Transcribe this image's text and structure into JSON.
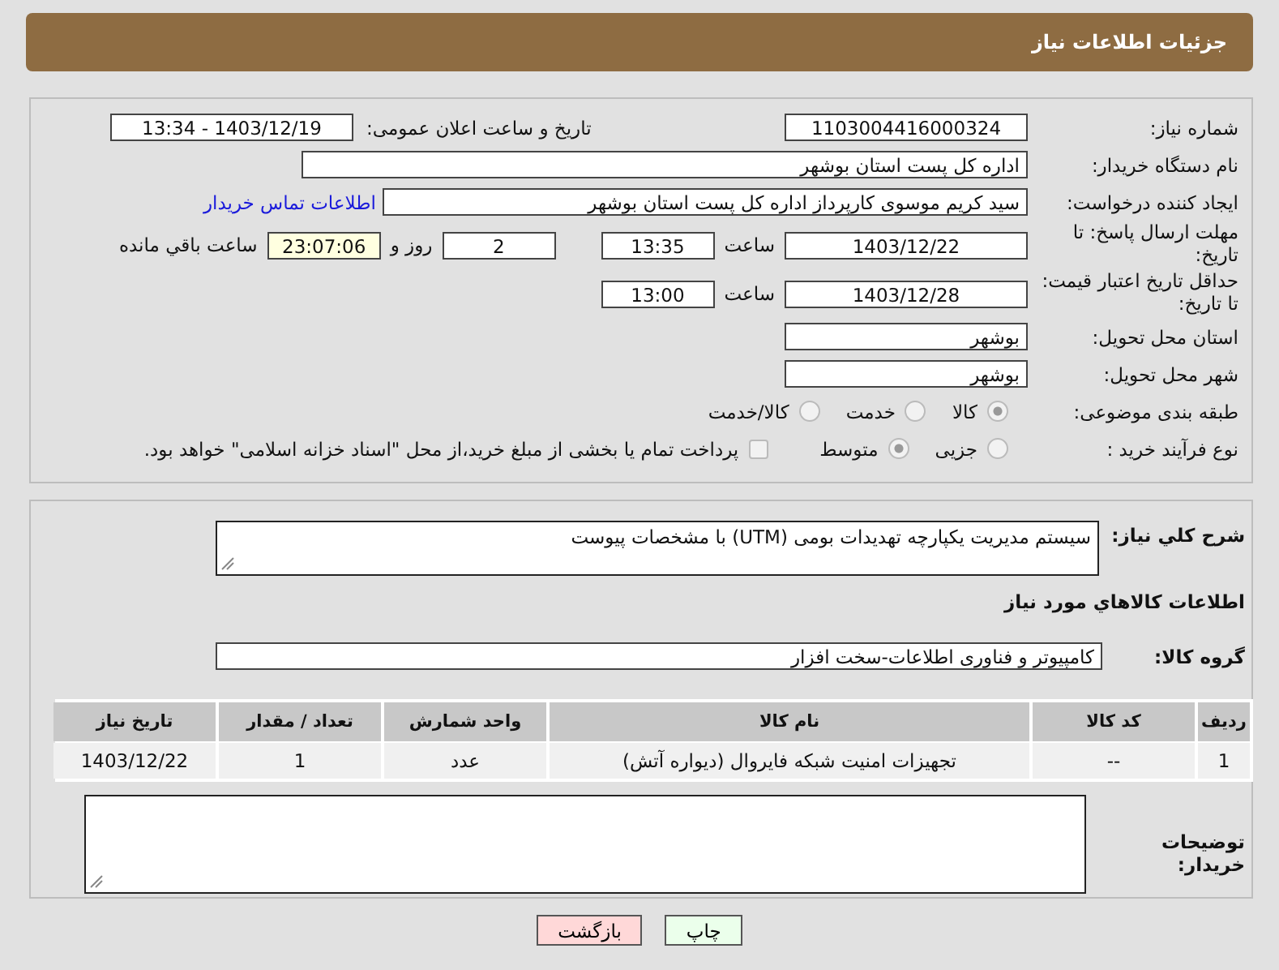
{
  "header": {
    "title": "جزئیات اطلاعات نیاز"
  },
  "need_number": {
    "label": "شماره نیاز:",
    "value": "1103004416000324"
  },
  "announce": {
    "label": "تاریخ و ساعت اعلان عمومی:",
    "value": "1403/12/19 - 13:34"
  },
  "buyer": {
    "label": "نام دستگاه خریدار:",
    "value": "اداره کل پست استان بوشهر"
  },
  "requester": {
    "label": "ایجاد کننده درخواست:",
    "value": "سید کریم موسوی کارپرداز اداره کل پست استان بوشهر",
    "link": "اطلاعات تماس خریدار"
  },
  "deadline": {
    "label": "مهلت ارسال پاسخ: تا تاریخ:",
    "date": "1403/12/22",
    "time_label": "ساعت",
    "time": "13:35",
    "days": "2",
    "days_label": "روز و",
    "remaining": "23:07:06",
    "remaining_label": "ساعت باقي مانده"
  },
  "validity": {
    "label": "حداقل تاریخ اعتبار قیمت: تا تاریخ:",
    "date": "1403/12/28",
    "time_label": "ساعت",
    "time": "13:00"
  },
  "province": {
    "label": "استان محل تحویل:",
    "value": "بوشهر"
  },
  "city": {
    "label": "شهر محل تحویل:",
    "value": "بوشهر"
  },
  "category": {
    "label": "طبقه بندی موضوعی:",
    "options": [
      {
        "label": "کالا",
        "selected": true
      },
      {
        "label": "خدمت",
        "selected": false
      },
      {
        "label": "کالا/خدمت",
        "selected": false
      }
    ]
  },
  "process": {
    "label": "نوع فرآیند خرید :",
    "options": [
      {
        "label": "جزیی",
        "selected": false
      },
      {
        "label": "متوسط",
        "selected": true
      }
    ],
    "payment": {
      "label": "پرداخت تمام یا بخشی از مبلغ خرید،از محل \"اسناد خزانه اسلامی\" خواهد بود.",
      "checked": false
    }
  },
  "description": {
    "label": "شرح کلي نياز:",
    "value": "سیستم مدیریت یکپارچه تهدیدات بومی  (UTM) با مشخصات پیوست"
  },
  "goods_title": "اطلاعات کالاهاي مورد نياز",
  "goods_group": {
    "label": "گروه کالا:",
    "value": "کامپیوتر و فناوری اطلاعات-سخت افزار"
  },
  "table": {
    "columns": [
      "ردیف",
      "کد کالا",
      "نام کالا",
      "واحد شمارش",
      "تعداد / مقدار",
      "تاریخ نیاز"
    ],
    "rows": [
      [
        "1",
        "--",
        "تجهیزات امنیت شبکه فایروال (دیواره آتش)",
        "عدد",
        "1",
        "1403/12/22"
      ]
    ]
  },
  "buyer_notes": {
    "label": "توضیحات خریدار:"
  },
  "buttons": [
    {
      "kind": "print",
      "label": "چاپ"
    },
    {
      "kind": "back",
      "label": "بازگشت"
    }
  ]
}
